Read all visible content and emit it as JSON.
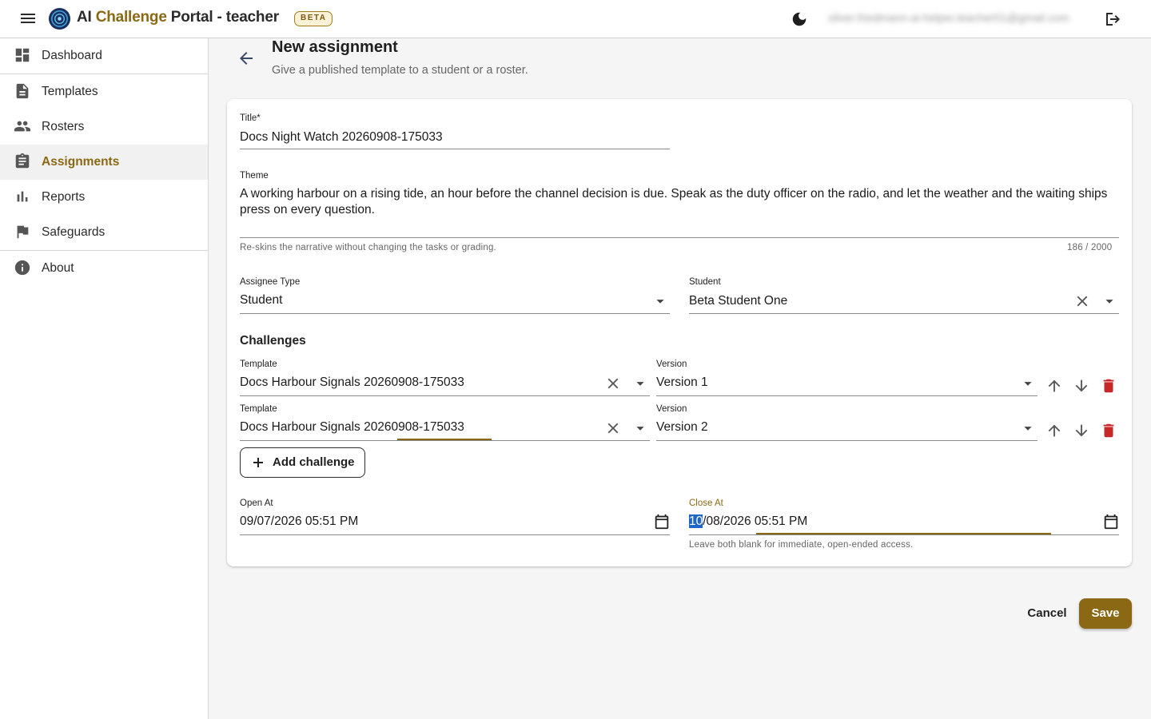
{
  "app": {
    "title_prefix": "AI ",
    "title_accent": "Challenge",
    "title_suffix": " Portal - teacher",
    "beta": "BETA",
    "user_email": "oliver.friedmann-ai-helper.teacher01@gmail.com",
    "icons": {
      "menu": "menu-icon",
      "logo": "portal-logo",
      "theme": "dark-mode-icon",
      "logout": "logout-icon"
    }
  },
  "sidebar": {
    "items": [
      {
        "label": "Dashboard",
        "icon": "dashboard-icon",
        "active": false
      },
      {
        "label": "Templates",
        "icon": "document-icon",
        "active": false
      },
      {
        "label": "Rosters",
        "icon": "people-icon",
        "active": false
      },
      {
        "label": "Assignments",
        "icon": "assignment-icon",
        "active": true
      },
      {
        "label": "Reports",
        "icon": "bar-chart-icon",
        "active": false
      },
      {
        "label": "Safeguards",
        "icon": "flag-icon",
        "active": false
      },
      {
        "label": "About",
        "icon": "info-icon",
        "active": false
      }
    ]
  },
  "page": {
    "title": "New assignment",
    "subtitle": "Give a published template to a student or a roster."
  },
  "form": {
    "title_label": "Title*",
    "title_value": "Docs Night Watch 20260908-175033",
    "theme_label": "Theme",
    "theme_value": "A working harbour on a rising tide, an hour before the channel decision is due. Speak as the duty officer on the radio, and let the weather and the waiting ships press on every question.",
    "theme_helper": "Re-skins the narrative without changing the tasks or grading.",
    "theme_counter": "186 / 2000",
    "assignee_type_label": "Assignee Type",
    "assignee_type_value": "Student",
    "student_label": "Student",
    "student_value": "Beta Student One",
    "challenges_heading": "Challenges",
    "challenges": [
      {
        "template_label": "Template",
        "template_value": "Docs Harbour Signals 20260908-175033",
        "version_label": "Version",
        "version_value": "Version 1"
      },
      {
        "template_label": "Template",
        "template_value": "Docs Harbour Signals 20260908-175033",
        "version_label": "Version",
        "version_value": "Version 2"
      }
    ],
    "add_challenge": "Add challenge",
    "open_at_label": "Open At",
    "open_at_value": "09/07/2026 05:51 PM",
    "close_at_label": "Close At",
    "close_at_selected": "10",
    "close_at_rest": "/08/2026 05:51 PM",
    "dates_helper": "Leave both blank for immediate, open-ended access."
  },
  "actions": {
    "cancel": "Cancel",
    "save": "Save"
  },
  "colors": {
    "accent": "#8b6914",
    "danger": "#c62828",
    "selection": "#1e66c9"
  }
}
